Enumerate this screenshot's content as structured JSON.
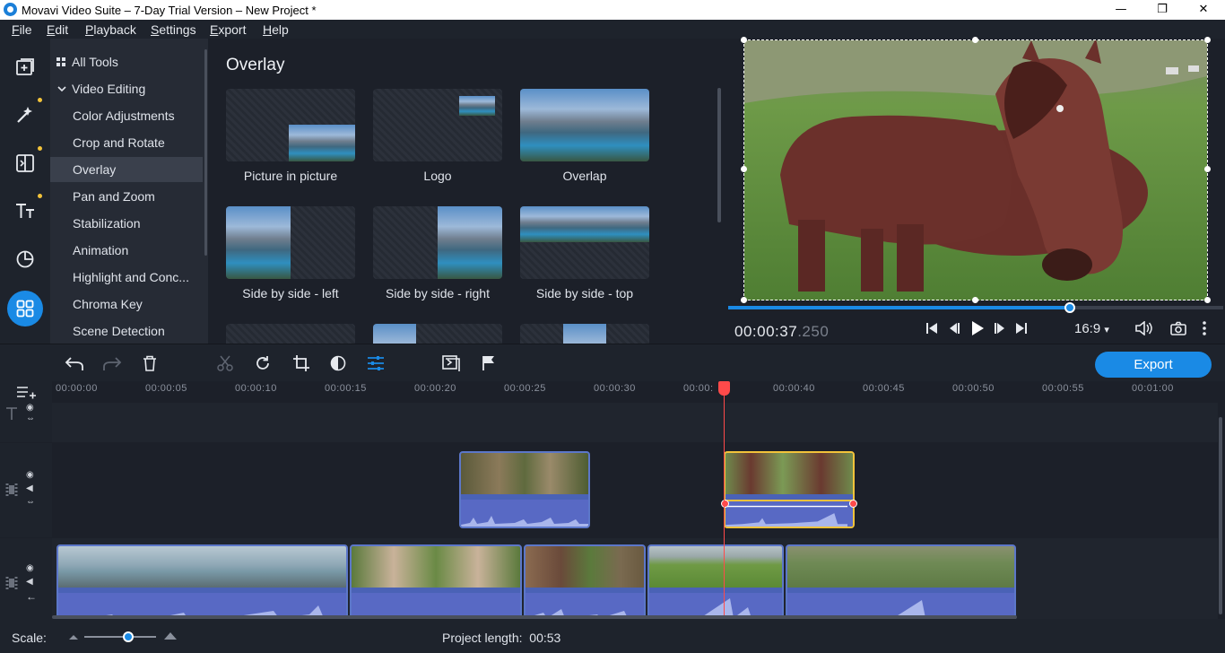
{
  "window": {
    "title": "Movavi Video Suite – 7-Day Trial Version – New Project *",
    "minimize": "—",
    "maximize": "❐",
    "close": "✕"
  },
  "menu": [
    "File",
    "Edit",
    "Playback",
    "Settings",
    "Export",
    "Help"
  ],
  "leftbar": {
    "items": [
      {
        "icon": "import-icon",
        "dot": false
      },
      {
        "icon": "magic-wand-icon",
        "dot": true
      },
      {
        "icon": "transitions-icon",
        "dot": true
      },
      {
        "icon": "titles-icon",
        "dot": true
      },
      {
        "icon": "stickers-icon",
        "dot": false
      },
      {
        "icon": "more-tools-icon",
        "dot": false,
        "active": true
      }
    ]
  },
  "tools_menu": {
    "all_tools": "All Tools",
    "category": "Video Editing",
    "items": [
      "Color Adjustments",
      "Crop and Rotate",
      "Overlay",
      "Pan and Zoom",
      "Stabilization",
      "Animation",
      "Highlight and Conc...",
      "Chroma Key",
      "Scene Detection"
    ],
    "active": "Overlay"
  },
  "gallery": {
    "title": "Overlay",
    "items": [
      "Picture in picture",
      "Logo",
      "Overlap",
      "Side by side - left",
      "Side by side - right",
      "Side by side - top"
    ]
  },
  "preview": {
    "timecode_main": "00:00:37",
    "timecode_ms": ".250",
    "aspect": "16:9",
    "progress": 0.69
  },
  "toolbar": {
    "export_label": "Export"
  },
  "timeline": {
    "ruler": [
      "00:00:00",
      "00:00:05",
      "00:00:10",
      "00:00:15",
      "00:00:20",
      "00:00:25",
      "00:00:30",
      "00:00:",
      "00:00:40",
      "00:00:45",
      "00:00:50",
      "00:00:55",
      "00:01:00"
    ]
  },
  "status": {
    "scale_label": "Scale:",
    "project_length_label": "Project length:",
    "project_length": "00:53"
  },
  "colors": {
    "accent": "#1a8ae5",
    "playhead": "#ff4a4a",
    "selected_clip": "#f3c33a",
    "clip": "#5c77c9"
  }
}
